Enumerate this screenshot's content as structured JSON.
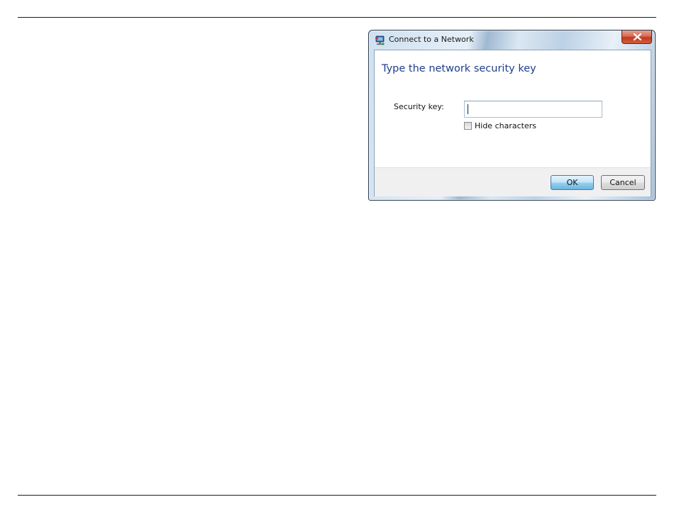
{
  "dialog": {
    "title": "Connect to a Network",
    "icon": "network-icon",
    "close_icon": "close-icon"
  },
  "content": {
    "instruction": "Type the network security key",
    "security_key_label": "Security key:",
    "security_key_value": "",
    "security_key_placeholder": "",
    "hide_characters_label": "Hide characters",
    "hide_characters_checked": false
  },
  "buttons": {
    "ok": "OK",
    "cancel": "Cancel"
  },
  "colors": {
    "instruction_text": "#1e3e8c",
    "close_button": "#c0391f",
    "ok_button_accent": "#3c7fb1"
  }
}
